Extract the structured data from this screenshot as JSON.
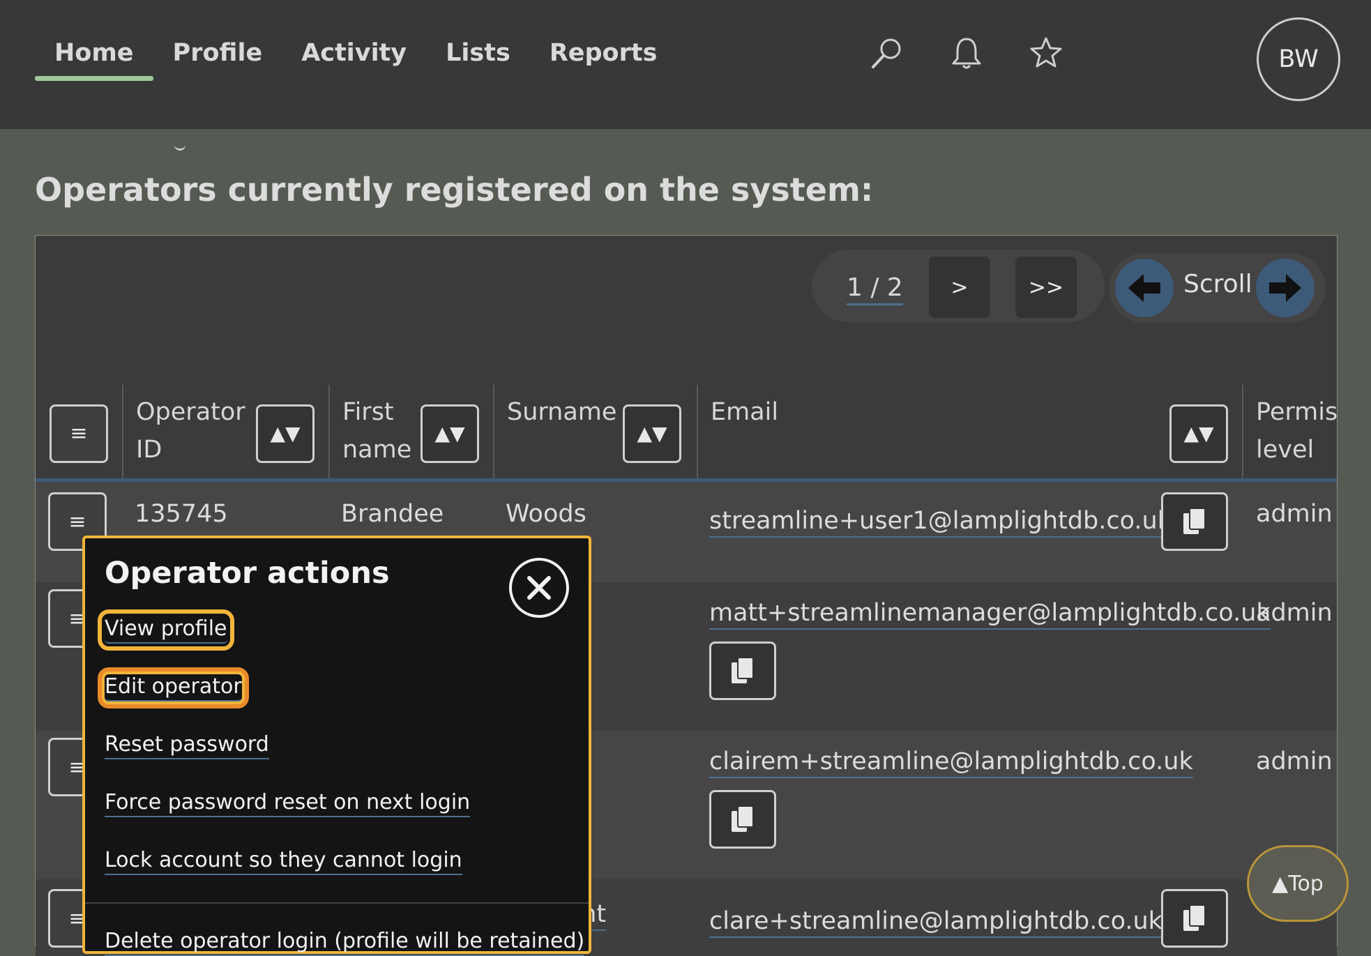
{
  "nav": {
    "items": [
      "Home",
      "Profile",
      "Activity",
      "Lists",
      "Reports"
    ],
    "active": "Home"
  },
  "header_icons": [
    "search-icon",
    "bell-icon",
    "star-icon"
  ],
  "avatar": {
    "initials": "BW"
  },
  "page": {
    "heading": "Operators currently registered on the system:"
  },
  "pager": {
    "label": "1 / 2",
    "next": ">",
    "last": ">>"
  },
  "scroll": {
    "label": "Scroll"
  },
  "table": {
    "columns": [
      "Operator ID",
      "First name",
      "Surname",
      "Email",
      "Permission level"
    ],
    "column_lines": [
      [
        "Operator",
        "ID"
      ],
      [
        "First",
        "name"
      ],
      [
        "Surname"
      ],
      [
        "Email"
      ],
      [
        "Permis",
        "level"
      ]
    ],
    "sort_glyph": "▲▼",
    "menu_glyph": "≡",
    "rows": [
      {
        "operator_id": "135745",
        "first_name": "Brandee",
        "surname": "Woods",
        "email": "streamline+user1@lamplightdb.co.uk",
        "permission": "admin"
      },
      {
        "operator_id": "",
        "first_name": "",
        "surname": "",
        "email": "matt+streamlinemanager@lamplightdb.co.uk",
        "permission": "admin"
      },
      {
        "operator_id": "",
        "first_name": "",
        "surname": "",
        "email": "clairem+streamline@lamplightdb.co.uk",
        "permission": "admin"
      },
      {
        "operator_id": "",
        "first_name": "",
        "surname": "ght",
        "email": "clare+streamline@lamplightdb.co.uk",
        "permission": ""
      }
    ]
  },
  "popup": {
    "title": "Operator actions",
    "actions": [
      "View profile",
      "Edit operator",
      "Reset password",
      "Force password reset on next login",
      "Lock account so they cannot login",
      "Delete operator login (profile will be retained)"
    ]
  },
  "top_button": {
    "label": "▲Top"
  },
  "colors": {
    "accent": "#f2b53a",
    "nav_active": "#9ec79a",
    "link_underline": "#4f6f8f",
    "scroll_button": "#3d5a78"
  }
}
